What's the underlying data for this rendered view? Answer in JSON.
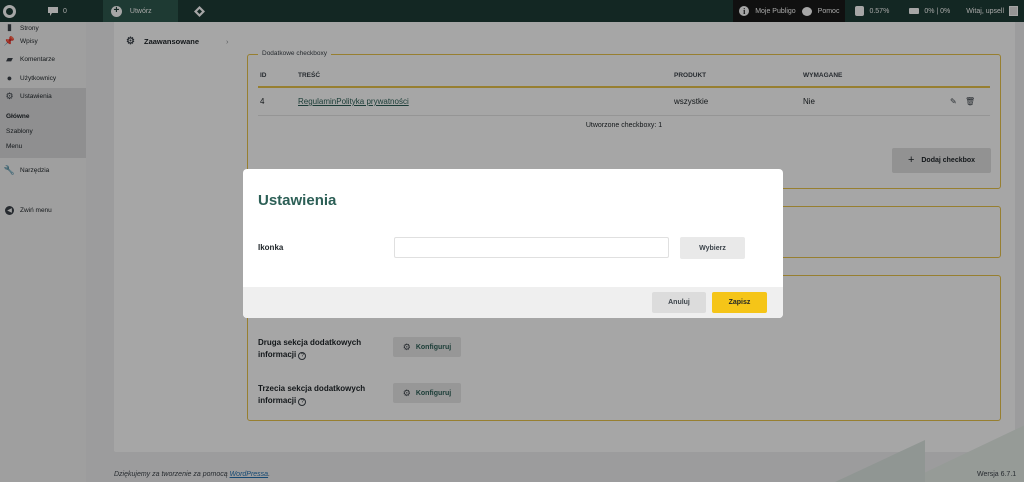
{
  "adminbar": {
    "comments_count": "0",
    "new_label": "Utwórz",
    "my_publigo": "Moje Publigo",
    "help": "Pomoc",
    "stat1": "0.57%",
    "stat2": "0% | 0%",
    "greeting": "Witaj, upsell"
  },
  "sidebar": {
    "items": [
      {
        "label": "Strony",
        "icon": "pages-icon"
      },
      {
        "label": "Wpisy",
        "icon": "pin-icon"
      },
      {
        "label": "Komentarze",
        "icon": "comment-icon"
      },
      {
        "label": "Użytkownicy",
        "icon": "user-icon"
      },
      {
        "label": "Ustawienia",
        "icon": "settings-icon"
      }
    ],
    "submenu": [
      "Główne",
      "Szablony",
      "Menu"
    ],
    "tools": "Narzędzia",
    "collapse": "Zwiń menu"
  },
  "main": {
    "tab_advanced": "Zaawansowane",
    "checkbox_legend": "Dodatkowe checkboxy",
    "table": {
      "headers": [
        "ID",
        "TREŚĆ",
        "PRODUKT",
        "WYMAGANE"
      ],
      "rows": [
        {
          "id": "4",
          "content": "RegulaminPolityka prywatności",
          "product": "wszystkie",
          "required": "Nie"
        }
      ]
    },
    "created": "Utworzone checkboxy: 1",
    "add_checkbox": "Dodaj checkbox",
    "section2_label": "Druga sekcja dodatkowych informacji",
    "section3_label": "Trzecia sekcja dodatkowych informacji",
    "configure": "Konfiguruj"
  },
  "footer": {
    "thanks": "Dziękujemy za tworzenie za pomocą",
    "wp_link": "WordPressa",
    "version": "Wersja 6.7.1"
  },
  "modal": {
    "title": "Ustawienia",
    "icon_label": "Ikonka",
    "icon_value": "",
    "choose": "Wybierz",
    "cancel": "Anuluj",
    "save": "Zapisz"
  },
  "colors": {
    "brand_dark": "#1e3d36",
    "accent_yellow": "#f5c518",
    "link_green": "#2c5f56"
  }
}
